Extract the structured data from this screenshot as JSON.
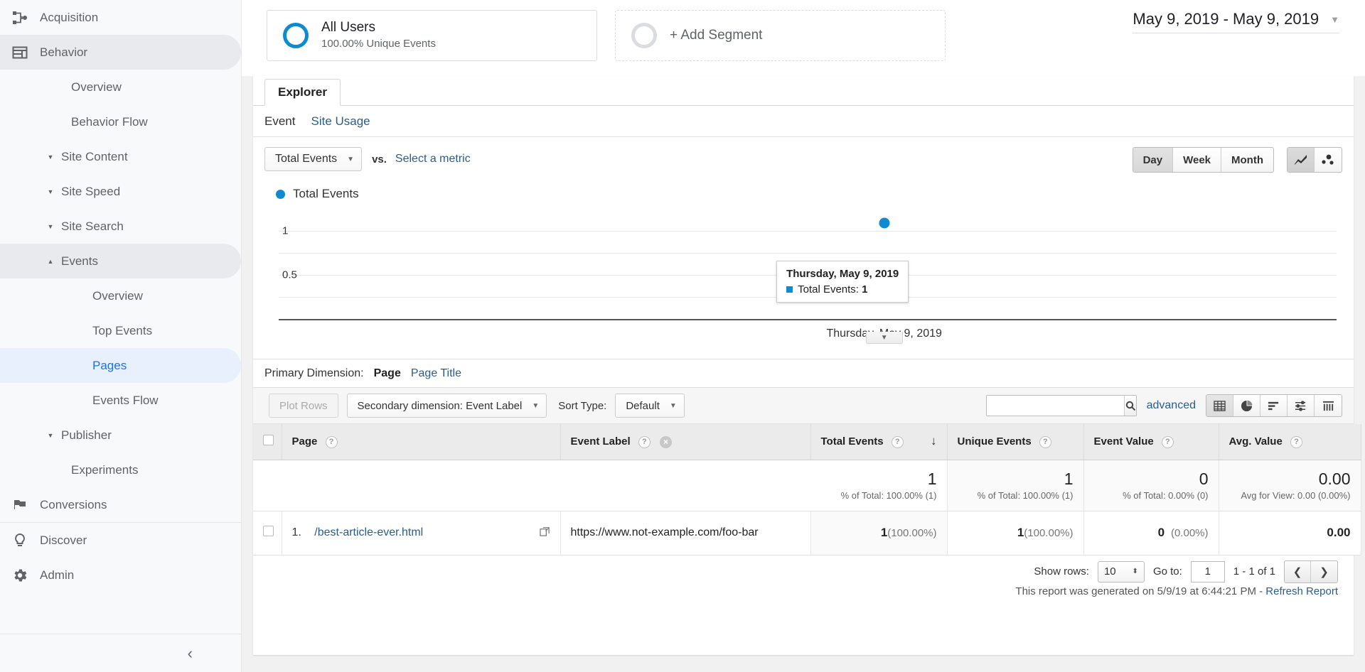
{
  "sidebar": {
    "items": [
      {
        "label": "Acquisition",
        "icon": "acquisition-icon",
        "level": 0,
        "state": "normal",
        "caret": ""
      },
      {
        "label": "Behavior",
        "icon": "behavior-icon",
        "level": 0,
        "state": "active-grey",
        "caret": ""
      },
      {
        "label": "Overview",
        "icon": "",
        "level": 1,
        "state": "normal",
        "caret": ""
      },
      {
        "label": "Behavior Flow",
        "icon": "",
        "level": 1,
        "state": "normal",
        "caret": ""
      },
      {
        "label": "Site Content",
        "icon": "",
        "level": 1,
        "state": "normal",
        "caret": "down"
      },
      {
        "label": "Site Speed",
        "icon": "",
        "level": 1,
        "state": "normal",
        "caret": "down"
      },
      {
        "label": "Site Search",
        "icon": "",
        "level": 1,
        "state": "normal",
        "caret": "down"
      },
      {
        "label": "Events",
        "icon": "",
        "level": 1,
        "state": "active-grey",
        "caret": "up"
      },
      {
        "label": "Overview",
        "icon": "",
        "level": 2,
        "state": "normal",
        "caret": ""
      },
      {
        "label": "Top Events",
        "icon": "",
        "level": 2,
        "state": "normal",
        "caret": ""
      },
      {
        "label": "Pages",
        "icon": "",
        "level": 2,
        "state": "active-blue",
        "caret": ""
      },
      {
        "label": "Events Flow",
        "icon": "",
        "level": 2,
        "state": "normal",
        "caret": ""
      },
      {
        "label": "Publisher",
        "icon": "",
        "level": 1,
        "state": "normal",
        "caret": "down"
      },
      {
        "label": "Experiments",
        "icon": "",
        "level": 1,
        "state": "normal",
        "caret": ""
      },
      {
        "label": "Conversions",
        "icon": "conversions-flag-icon",
        "level": 0,
        "state": "normal",
        "caret": ""
      },
      {
        "label": "Discover",
        "icon": "discover-bulb-icon",
        "level": 0,
        "state": "normal",
        "caret": ""
      },
      {
        "label": "Admin",
        "icon": "admin-gear-icon",
        "level": 0,
        "state": "normal",
        "caret": ""
      }
    ]
  },
  "segments": {
    "applied": {
      "name": "All Users",
      "subtitle": "100.00% Unique Events"
    },
    "add_label": "+ Add Segment"
  },
  "date_range": {
    "text": "May 9, 2019 - May 9, 2019"
  },
  "tabs": {
    "explorer": "Explorer"
  },
  "subtabs": {
    "event": "Event",
    "site_usage": "Site Usage"
  },
  "metric_row": {
    "primary_metric": "Total Events",
    "vs": "vs.",
    "select_metric": "Select a metric"
  },
  "chart_controls": {
    "day": "Day",
    "week": "Week",
    "month": "Month",
    "active_granularity": "Day",
    "line_chart_icon": "line-chart-icon",
    "scatter_chart_icon": "scatter-chart-icon"
  },
  "chart_data": {
    "type": "line",
    "title": "Total Events",
    "series": [
      {
        "name": "Total Events",
        "values": [
          1
        ],
        "color": "#0e8bd0"
      }
    ],
    "categories": [
      "Thursday, May 9, 2019"
    ],
    "x": [
      "2019-05-09"
    ],
    "ylabel": "",
    "xlabel": "",
    "yticks": [
      "1",
      "0.5"
    ],
    "ytick_values": [
      1,
      0.5
    ],
    "ylim": [
      0,
      1.2
    ],
    "grid": true,
    "legend": {
      "position": "top-left",
      "entries": [
        "Total Events"
      ]
    },
    "xtick_labels": [
      "Thursday, May 9, 2019"
    ],
    "tooltip": {
      "title": "Thursday, May 9, 2019",
      "metric": "Total Events:",
      "value": "1"
    }
  },
  "primary_dimension": {
    "label": "Primary Dimension:",
    "active": "Page",
    "alternate": "Page Title"
  },
  "table_toolbar": {
    "plot_rows": "Plot Rows",
    "secondary_dimension": "Secondary dimension: Event Label",
    "sort_type_label": "Sort Type:",
    "sort_type_value": "Default",
    "search_value": "",
    "search_placeholder": "",
    "advanced": "advanced",
    "view_icons": [
      "table-view-icon",
      "pie-view-icon",
      "bar-view-icon",
      "comparison-view-icon",
      "pivot-view-icon"
    ],
    "active_view": "table-view-icon"
  },
  "table": {
    "columns": [
      {
        "label": "Page",
        "help": "?",
        "removable": false,
        "sorted": false
      },
      {
        "label": "Event Label",
        "help": "?",
        "removable": true,
        "sorted": false
      },
      {
        "label": "Total Events",
        "help": "?",
        "removable": false,
        "sorted": true
      },
      {
        "label": "Unique Events",
        "help": "?",
        "removable": false,
        "sorted": false
      },
      {
        "label": "Event Value",
        "help": "?",
        "removable": false,
        "sorted": false
      },
      {
        "label": "Avg. Value",
        "help": "?",
        "removable": false,
        "sorted": false
      }
    ],
    "summary": [
      {
        "value": "1",
        "note": "% of Total: 100.00% (1)"
      },
      {
        "value": "1",
        "note": "% of Total: 100.00% (1)"
      },
      {
        "value": "0",
        "note": "% of Total: 0.00% (0)"
      },
      {
        "value": "0.00",
        "note": "Avg for View: 0.00 (0.00%)"
      }
    ],
    "rows": [
      {
        "rank": "1.",
        "page": "/best-article-ever.html",
        "event_label": "https://www.not-example.com/foo-bar",
        "total_events": "1",
        "total_events_pct": "(100.00%)",
        "unique_events": "1",
        "unique_events_pct": "(100.00%)",
        "event_value": "0",
        "event_value_pct": "(0.00%)",
        "avg_value": "0.00"
      }
    ]
  },
  "pagination": {
    "show_rows_label": "Show rows:",
    "show_rows_value": "10",
    "go_to_label": "Go to:",
    "go_to_value": "1",
    "range_text": "1 - 1 of 1",
    "prev_icon": "chevron-left-icon",
    "next_icon": "chevron-right-icon"
  },
  "footer": {
    "generated_text": "This report was generated on 5/9/19 at 6:44:21 PM - ",
    "refresh_link": "Refresh Report"
  }
}
